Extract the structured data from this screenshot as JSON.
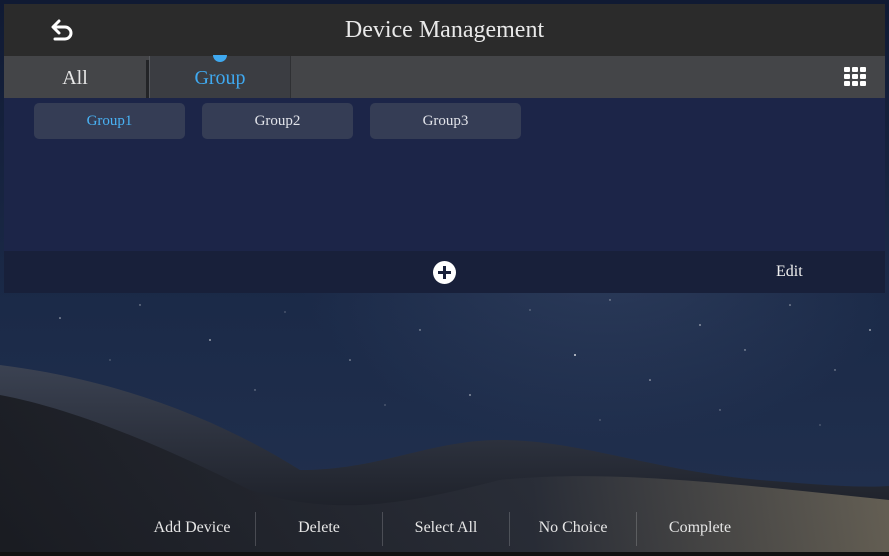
{
  "header": {
    "title": "Device Management"
  },
  "tabs": [
    {
      "label": "All",
      "active": false
    },
    {
      "label": "Group",
      "active": true
    }
  ],
  "groups": [
    {
      "label": "Group1",
      "selected": true
    },
    {
      "label": "Group2",
      "selected": false
    },
    {
      "label": "Group3",
      "selected": false
    }
  ],
  "actions": {
    "edit_label": "Edit"
  },
  "toolbar": {
    "add_device": "Add Device",
    "delete": "Delete",
    "select_all": "Select All",
    "no_choice": "No Choice",
    "complete": "Complete"
  },
  "colors": {
    "accent": "#3fa9f0",
    "title_bar": "#2b2b2b",
    "tab_bar": "#444548",
    "group_panel": "#1c2548"
  },
  "icons": {
    "back": "back-arrow-icon",
    "grid": "grid-menu-icon",
    "add": "plus-circle-icon"
  }
}
